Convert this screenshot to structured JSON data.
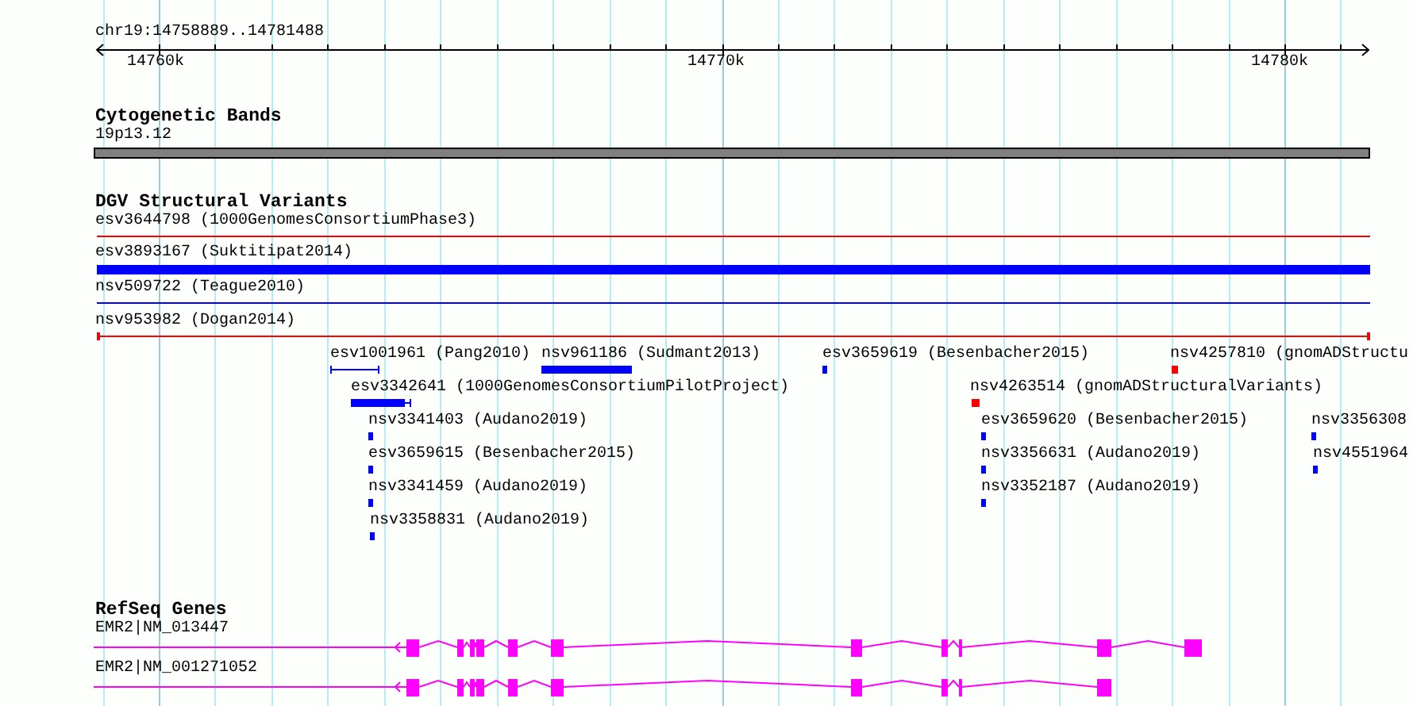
{
  "ruler": {
    "location": "chr19:14758889..14781488",
    "ticks": [
      "14760k",
      "14770k",
      "14780k"
    ]
  },
  "tracks": [
    {
      "kind": "cytoband",
      "title": "Cytogenetic Bands",
      "features": [
        {
          "label": "19p13.12"
        }
      ]
    },
    {
      "kind": "variants",
      "title": "DGV Structural Variants",
      "features": [
        {
          "label": "esv3644798 (1000GenomesConsortiumPhase3)",
          "kind": "line",
          "color": "#ff0000"
        },
        {
          "label": "esv3893167 (Suktitipat2014)",
          "kind": "bar",
          "color": "#0000ff"
        },
        {
          "label": "nsv509722 (Teague2010)",
          "kind": "line",
          "color": "#0000ff"
        },
        {
          "label": "nsv953982 (Dogan2014)",
          "kind": "span",
          "color": "#ff0000"
        },
        {
          "label": "esv1001961 (Pang2010)",
          "kind": "span",
          "color": "#0000ff"
        },
        {
          "label": "nsv961186 (Sudmant2013)",
          "kind": "bar",
          "color": "#0000ff"
        },
        {
          "label": "esv3659619 (Besenbacher2015)",
          "kind": "bar",
          "color": "#0000ff"
        },
        {
          "label": "nsv4257810 (gnomADStructu",
          "kind": "bar",
          "color": "#ff0000"
        },
        {
          "label": "esv3342641 (1000GenomesConsortiumPilotProject)",
          "kind": "bar",
          "color": "#0000ff"
        },
        {
          "label": "nsv4263514 (gnomADStructuralVariants)",
          "kind": "bar",
          "color": "#ff0000"
        },
        {
          "label": "nsv3341403 (Audano2019)",
          "kind": "bar",
          "color": "#0000ff"
        },
        {
          "label": "esv3659620 (Besenbacher2015)",
          "kind": "bar",
          "color": "#0000ff"
        },
        {
          "label": "nsv3356308",
          "kind": "bar",
          "color": "#0000ff"
        },
        {
          "label": "esv3659615 (Besenbacher2015)",
          "kind": "bar",
          "color": "#0000ff"
        },
        {
          "label": "nsv3356631 (Audano2019)",
          "kind": "bar",
          "color": "#0000ff"
        },
        {
          "label": "nsv4551964",
          "kind": "bar",
          "color": "#0000ff"
        },
        {
          "label": "nsv3341459 (Audano2019)",
          "kind": "bar",
          "color": "#0000ff"
        },
        {
          "label": "nsv3352187 (Audano2019)",
          "kind": "bar",
          "color": "#0000ff"
        },
        {
          "label": "nsv3358831 (Audano2019)",
          "kind": "bar",
          "color": "#0000ff"
        }
      ]
    },
    {
      "kind": "genes",
      "title": "RefSeq Genes",
      "features": [
        {
          "label": "EMR2|NM_013447"
        },
        {
          "label": "EMR2|NM_001271052"
        }
      ]
    }
  ]
}
